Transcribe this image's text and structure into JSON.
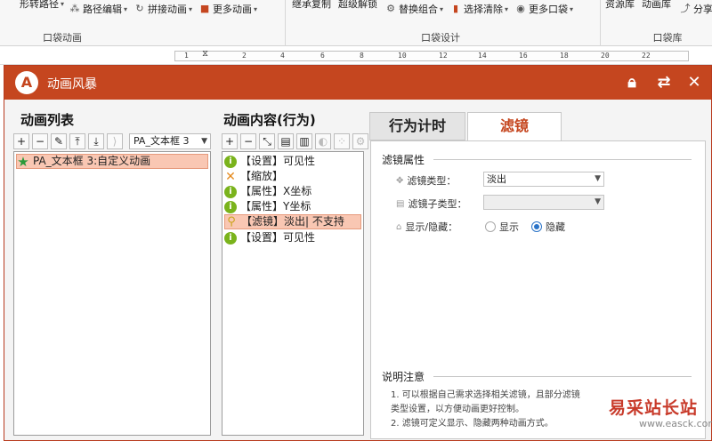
{
  "ribbon": {
    "row1": [
      {
        "label": "形转路径",
        "icon": "shape-path-icon"
      },
      {
        "label": "路径编辑",
        "icon": "path-edit-icon"
      },
      {
        "label": "拼接动画",
        "icon": "splice-icon"
      },
      {
        "label": "更多动画",
        "icon": "more-anim-icon"
      },
      {
        "label": "继承复制",
        "icon": "inherit-copy-icon"
      },
      {
        "label": "超级解锁",
        "icon": "unlock-icon"
      },
      {
        "label": "替换组合",
        "icon": "replace-icon"
      },
      {
        "label": "选择清除",
        "icon": "clear-icon"
      },
      {
        "label": "更多口袋",
        "icon": "more-pocket-icon"
      },
      {
        "label": "资源库",
        "icon": "resource-icon"
      },
      {
        "label": "动画库",
        "icon": "anim-lib-icon"
      },
      {
        "label": "分享",
        "icon": "share-icon"
      }
    ],
    "groups": [
      "口袋动画",
      "口袋设计",
      "口袋库"
    ]
  },
  "ruler": {
    "ticks": [
      "1",
      "2",
      "4",
      "6",
      "8",
      "10",
      "12",
      "14",
      "16",
      "18",
      "20",
      "22"
    ]
  },
  "window": {
    "title": "动画风暴",
    "logo": "A",
    "icons": [
      "lock-icon",
      "refresh-icon",
      "close-icon"
    ]
  },
  "anim_list": {
    "title": "动画列表",
    "combo_value": "PA_文本框 3",
    "items": [
      {
        "label": "PA_文本框 3:自定义动画",
        "icon": "star-icon",
        "selected": true
      }
    ]
  },
  "anim_content": {
    "title": "动画内容(行为)",
    "items": [
      {
        "label": "【设置】可见性",
        "icon": "info-icon",
        "selected": false
      },
      {
        "label": "【缩放】",
        "icon": "scale-icon",
        "selected": false
      },
      {
        "label": "【属性】X坐标",
        "icon": "info-icon",
        "selected": false
      },
      {
        "label": "【属性】Y坐标",
        "icon": "info-icon",
        "selected": false
      },
      {
        "label": "【滤镜】淡出| 不支持",
        "icon": "filter-icon",
        "selected": true
      },
      {
        "label": "【设置】可见性",
        "icon": "info-icon",
        "selected": false
      }
    ]
  },
  "tabs": {
    "timing": "行为计时",
    "filter": "滤镜",
    "active": "filter"
  },
  "filter_props": {
    "section_title": "滤镜属性",
    "type_label": "滤镜类型：",
    "type_value": "淡出",
    "subtype_label": "滤镜子类型：",
    "subtype_value": "",
    "visibility_label": "显示/隐藏：",
    "radio_show": "显示",
    "radio_hide": "隐藏",
    "visibility_selected": "隐藏"
  },
  "notes": {
    "section_title": "说明注意",
    "line1": "1. 可以根据自己需求选择相关滤镜，且部分滤镜",
    "line2": "类型设置，以方便动画更好控制。",
    "line3": "2. 滤镜可定义显示、隐藏两种动画方式。"
  },
  "watermark": {
    "text": "易采站长站",
    "sub": "www.easck.com"
  },
  "colors": {
    "accent": "#c5461f",
    "selection": "#f9c7b3",
    "tab_active_text": "#c5461f"
  }
}
